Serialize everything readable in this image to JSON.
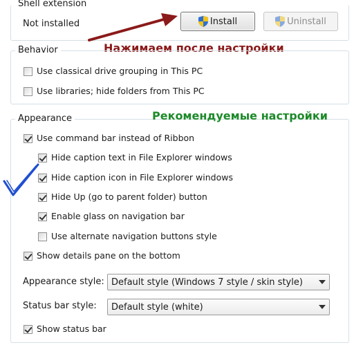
{
  "shell_extension": {
    "title": "Shell extension",
    "status": "Not installed",
    "install_label": "Install",
    "uninstall_label": "Uninstall"
  },
  "behavior": {
    "title": "Behavior",
    "items": [
      {
        "label": "Use classical drive grouping in This PC",
        "checked": false
      },
      {
        "label": "Use libraries; hide folders from This PC",
        "checked": false
      }
    ]
  },
  "appearance": {
    "title": "Appearance",
    "items": [
      {
        "label": "Use command bar instead of Ribbon",
        "checked": true
      },
      {
        "label": "Hide caption text in File Explorer windows",
        "checked": true
      },
      {
        "label": "Hide caption icon in File Explorer windows",
        "checked": true
      },
      {
        "label": "Hide Up (go to parent folder) button",
        "checked": true
      },
      {
        "label": "Enable glass on navigation bar",
        "checked": true
      },
      {
        "label": "Use alternate navigation buttons style",
        "checked": false
      },
      {
        "label": "Show details pane on the bottom",
        "checked": true
      }
    ],
    "appearance_style_label": "Appearance style:",
    "appearance_style_value": "Default style (Windows 7 style / skin style)",
    "status_bar_style_label": "Status bar style:",
    "status_bar_style_value": "Default style (white)",
    "show_status_bar": {
      "label": "Show status bar",
      "checked": true
    }
  },
  "annotations": {
    "after_settings": "Нажимаем после настройки",
    "recommended": "Рекомендуемые настройки"
  },
  "colors": {
    "annotation_red": "#8b1a1a",
    "annotation_green": "#1d8a2a",
    "checkmark_blue": "#1f4fd1",
    "shield_blue": "#2f6fd0",
    "shield_yellow": "#f2c318"
  },
  "icons": {
    "install": "uac-shield-icon",
    "uninstall": "uac-shield-icon",
    "annotation_arrow": "arrow-right-icon",
    "annotation_check": "large-checkmark-icon"
  }
}
